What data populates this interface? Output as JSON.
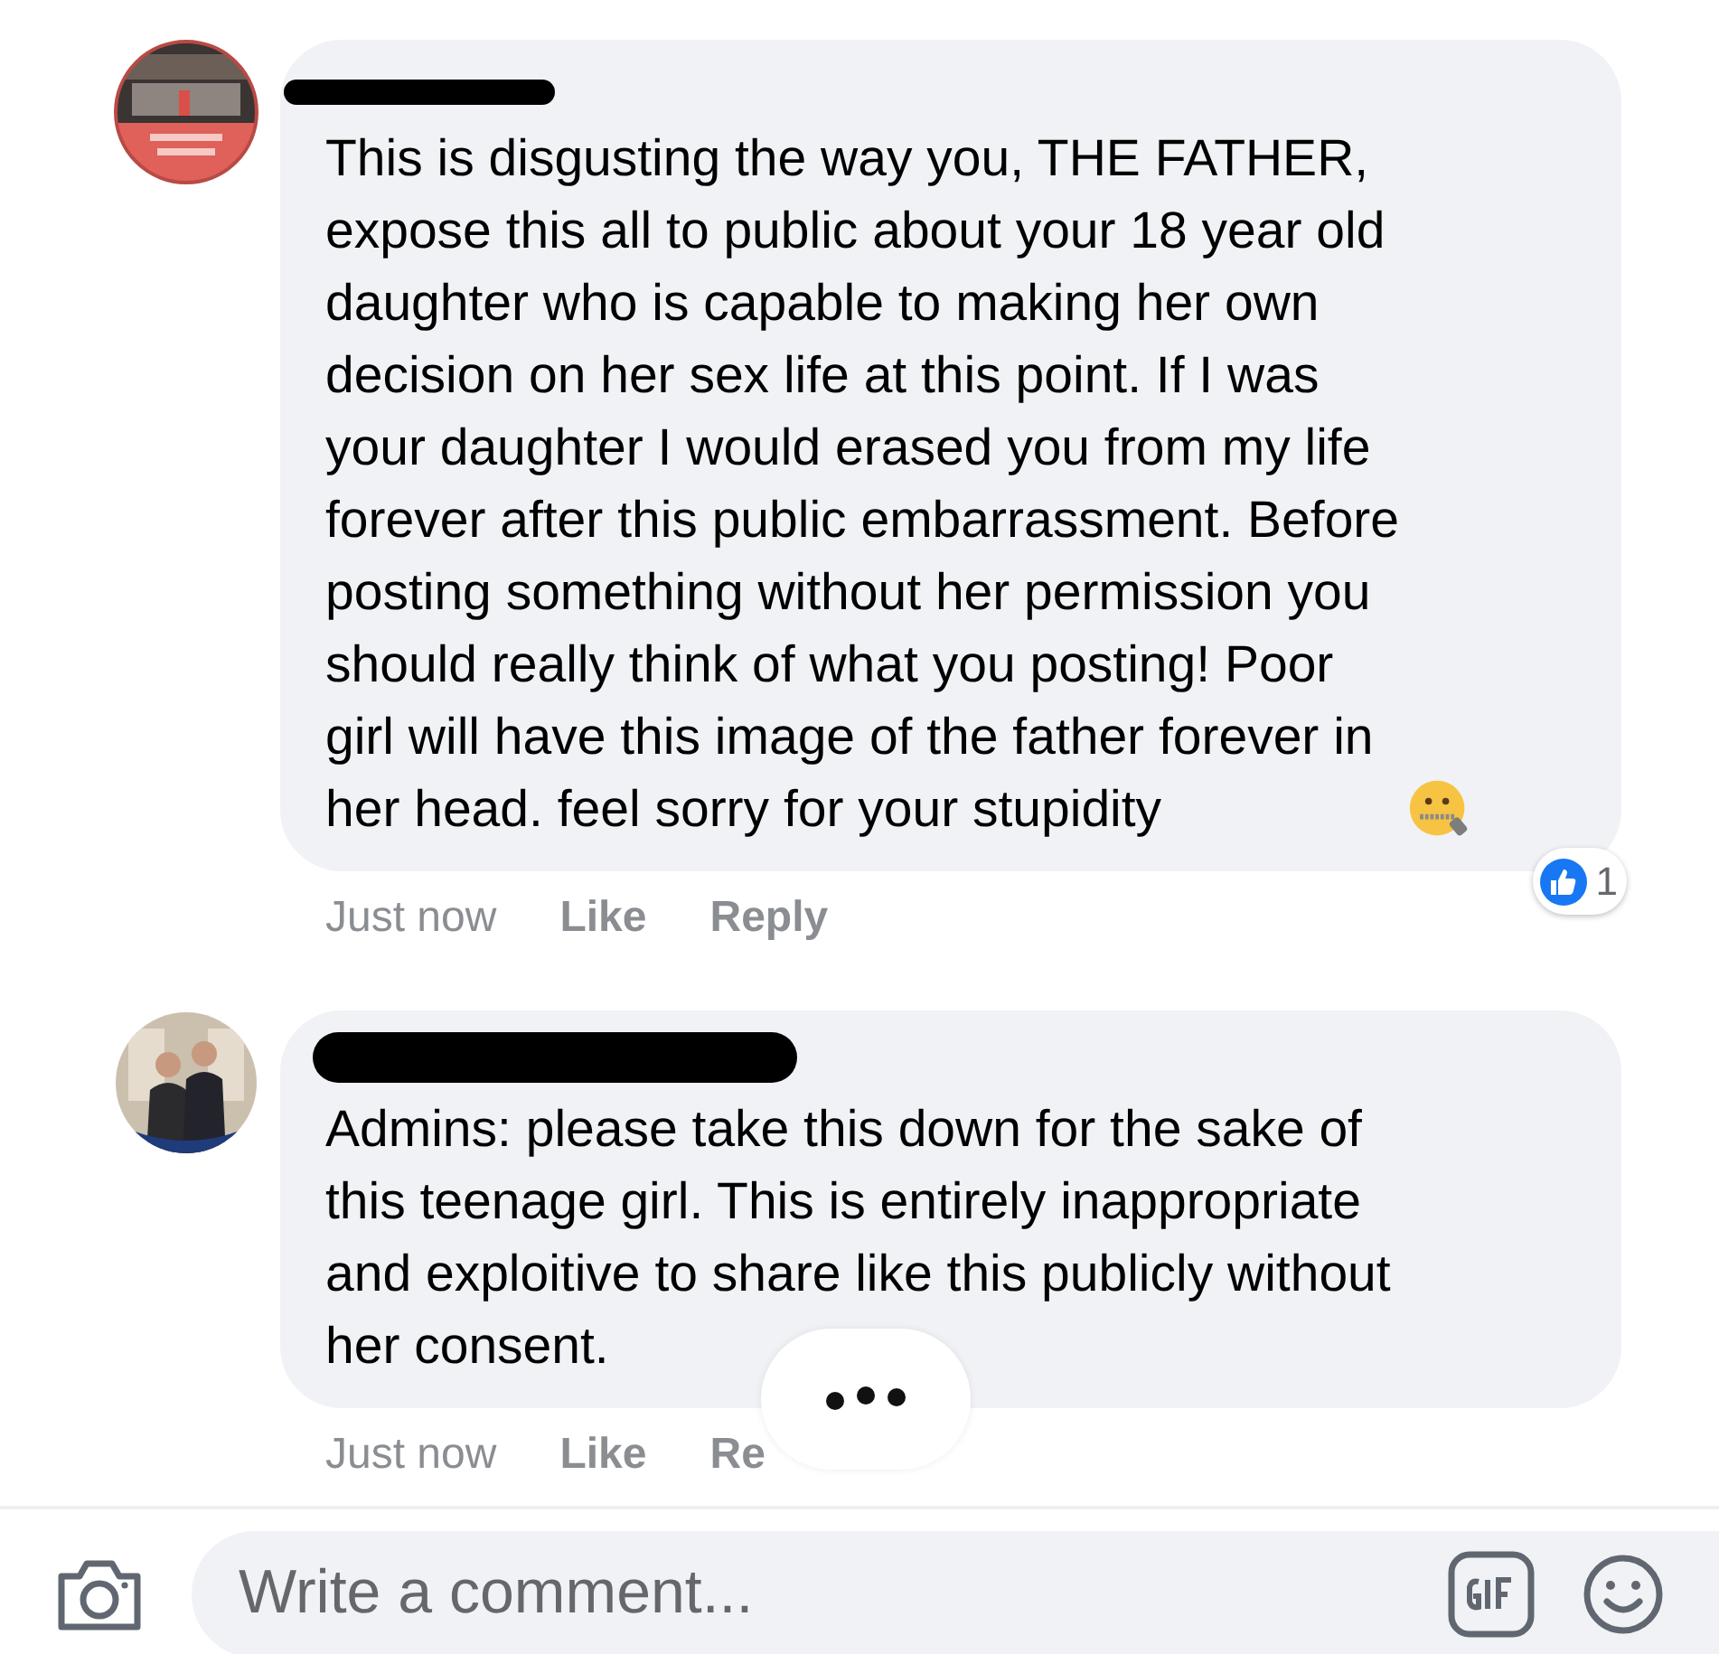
{
  "comments": [
    {
      "lines": [
        "This is disgusting the way you, THE FATHER,",
        "expose this all to public about your 18 year old",
        "daughter who is capable to making her own",
        "decision on her sex life at this point. If I was",
        "your daughter I would erased you from my life",
        "forever after this public embarrassment. Before",
        "posting something without her permission you",
        "should really think of what you posting! Poor",
        "girl will have this image of the father forever in",
        "her head. feel sorry for your stupidity"
      ],
      "emoji": true,
      "time": "Just now",
      "actions": [
        "Like",
        "Reply"
      ],
      "reaction_count": "1",
      "typing": false
    },
    {
      "lines": [
        "Admins: please take this down for the sake of",
        "this teenage girl. This is entirely inappropriate",
        "and exploitive to share like this publicly without",
        "her consent."
      ],
      "emoji": false,
      "time": "Just now",
      "actions": [
        "Like",
        "Re"
      ],
      "typing": true
    }
  ],
  "composer": {
    "placeholder": "Write a comment..."
  }
}
